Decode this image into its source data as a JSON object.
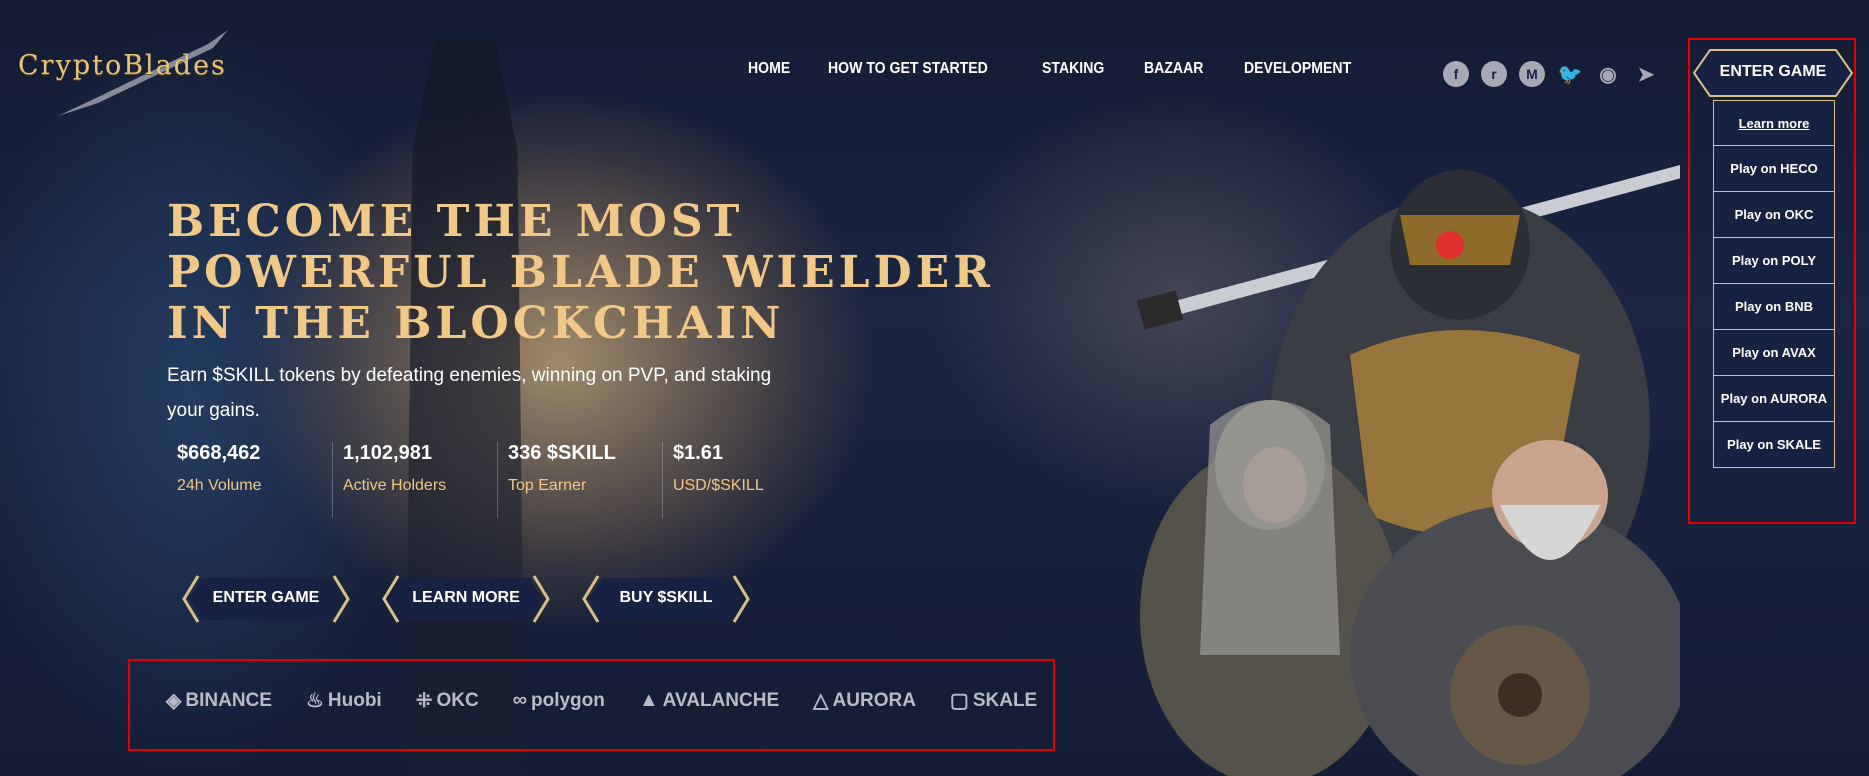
{
  "brand": {
    "logo_text": "CryptoBlades"
  },
  "nav": {
    "items": [
      "HOME",
      "HOW TO GET STARTED",
      "STAKING",
      "BAZAAR",
      "DEVELOPMENT"
    ]
  },
  "social": [
    {
      "icon": "facebook-icon",
      "glyph": "f"
    },
    {
      "icon": "reddit-icon",
      "glyph": "r"
    },
    {
      "icon": "medium-icon",
      "glyph": "M"
    },
    {
      "icon": "twitter-icon",
      "glyph": "🐦"
    },
    {
      "icon": "discord-icon",
      "glyph": "◉"
    },
    {
      "icon": "telegram-icon",
      "glyph": "➤"
    }
  ],
  "enter_game_menu": {
    "label": "ENTER GAME",
    "items": [
      "Learn more",
      "Play on HECO",
      "Play on OKC",
      "Play on POLY",
      "Play on BNB",
      "Play on AVAX",
      "Play on AURORA",
      "Play on SKALE"
    ]
  },
  "hero": {
    "title": "BECOME THE MOST\nPOWERFUL BLADE WIELDER\nIN THE BLOCKCHAIN",
    "subtitle": "Earn $SKILL tokens by defeating enemies, winning on PVP, and staking your gains."
  },
  "stats": [
    {
      "value": "$668,462",
      "label": "24h Volume"
    },
    {
      "value": "1,102,981",
      "label": "Active Holders"
    },
    {
      "value": "336 $SKILL",
      "label": "Top Earner"
    },
    {
      "value": "$1.61",
      "label": "USD/$SKILL"
    }
  ],
  "buttons": {
    "enter_game": "ENTER GAME",
    "learn_more": "LEARN MORE",
    "buy_skill": "BUY $SKILL"
  },
  "exchanges": [
    {
      "name": "BINANCE",
      "icon": "binance-icon",
      "glyph": "◈"
    },
    {
      "name": "Huobi",
      "icon": "huobi-icon",
      "glyph": "♨"
    },
    {
      "name": "OKC",
      "icon": "okc-icon",
      "glyph": "⁜"
    },
    {
      "name": "polygon",
      "icon": "polygon-icon",
      "glyph": "∞"
    },
    {
      "name": "AVALANCHE",
      "icon": "avalanche-icon",
      "glyph": "▲"
    },
    {
      "name": "AURORA",
      "icon": "aurora-icon",
      "glyph": "△"
    },
    {
      "name": "SKALE",
      "icon": "skale-icon",
      "glyph": "▢"
    }
  ],
  "colors": {
    "gold": "#f0c887",
    "highlight_box": "#e00000",
    "navy": "#172242"
  }
}
